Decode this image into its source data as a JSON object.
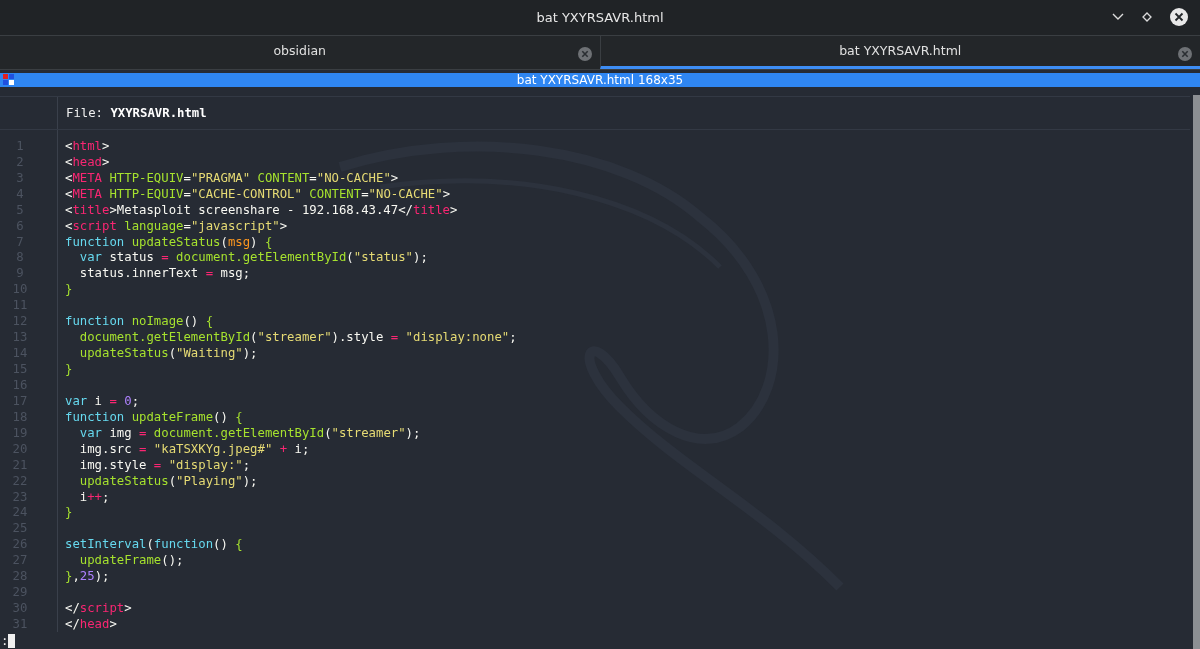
{
  "window": {
    "title": "bat YXYRSAVR.html"
  },
  "tabs": [
    {
      "label": "obsidian",
      "selected": false
    },
    {
      "label": "bat YXYRSAVR.html",
      "selected": true
    }
  ],
  "terminal": {
    "title": "bat YXYRSAVR.html 168x35",
    "file_label": "File:",
    "file_name": "YXYRSAVR.html",
    "lines": [
      {
        "number": "1",
        "tokens": [
          {
            "kind": "plain",
            "text": "<"
          },
          {
            "kind": "tag",
            "text": "html"
          },
          {
            "kind": "plain",
            "text": ">"
          }
        ]
      },
      {
        "number": "2",
        "tokens": [
          {
            "kind": "plain",
            "text": "<"
          },
          {
            "kind": "tag",
            "text": "head"
          },
          {
            "kind": "plain",
            "text": ">"
          }
        ]
      },
      {
        "number": "3",
        "tokens": [
          {
            "kind": "plain",
            "text": "<"
          },
          {
            "kind": "tag",
            "text": "META"
          },
          {
            "kind": "attr",
            "text": " HTTP-EQUIV"
          },
          {
            "kind": "plain",
            "text": "="
          },
          {
            "kind": "str",
            "text": "\"PRAGMA\""
          },
          {
            "kind": "attr",
            "text": " CONTENT"
          },
          {
            "kind": "plain",
            "text": "="
          },
          {
            "kind": "str",
            "text": "\"NO-CACHE\""
          },
          {
            "kind": "plain",
            "text": ">"
          }
        ]
      },
      {
        "number": "4",
        "tokens": [
          {
            "kind": "plain",
            "text": "<"
          },
          {
            "kind": "tag",
            "text": "META"
          },
          {
            "kind": "attr",
            "text": " HTTP-EQUIV"
          },
          {
            "kind": "plain",
            "text": "="
          },
          {
            "kind": "str",
            "text": "\"CACHE-CONTROL\""
          },
          {
            "kind": "attr",
            "text": " CONTENT"
          },
          {
            "kind": "plain",
            "text": "="
          },
          {
            "kind": "str",
            "text": "\"NO-CACHE\""
          },
          {
            "kind": "plain",
            "text": ">"
          }
        ]
      },
      {
        "number": "5",
        "tokens": [
          {
            "kind": "plain",
            "text": "<"
          },
          {
            "kind": "tag",
            "text": "title"
          },
          {
            "kind": "plain",
            "text": ">Metasploit screenshare - 192.168.43.47</"
          },
          {
            "kind": "tag",
            "text": "title"
          },
          {
            "kind": "plain",
            "text": ">"
          }
        ]
      },
      {
        "number": "6",
        "tokens": [
          {
            "kind": "plain",
            "text": "<"
          },
          {
            "kind": "tag",
            "text": "script"
          },
          {
            "kind": "attr",
            "text": " language"
          },
          {
            "kind": "plain",
            "text": "="
          },
          {
            "kind": "str",
            "text": "\"javascript\""
          },
          {
            "kind": "plain",
            "text": ">"
          }
        ]
      },
      {
        "number": "7",
        "tokens": [
          {
            "kind": "kw",
            "text": "function"
          },
          {
            "kind": "fn",
            "text": " updateStatus"
          },
          {
            "kind": "plain",
            "text": "("
          },
          {
            "kind": "param",
            "text": "msg"
          },
          {
            "kind": "plain",
            "text": ")"
          },
          {
            "kind": "fn",
            "text": " {"
          }
        ]
      },
      {
        "number": "8",
        "tokens": [
          {
            "kind": "kw",
            "text": "  var"
          },
          {
            "kind": "plain",
            "text": " status "
          },
          {
            "kind": "op",
            "text": "="
          },
          {
            "kind": "fn",
            "text": " document.getElementById"
          },
          {
            "kind": "plain",
            "text": "("
          },
          {
            "kind": "str",
            "text": "\"status\""
          },
          {
            "kind": "plain",
            "text": ");"
          }
        ]
      },
      {
        "number": "9",
        "tokens": [
          {
            "kind": "plain",
            "text": "  status.innerText "
          },
          {
            "kind": "op",
            "text": "="
          },
          {
            "kind": "plain",
            "text": " msg;"
          }
        ]
      },
      {
        "number": "10",
        "tokens": [
          {
            "kind": "fn",
            "text": "}"
          }
        ]
      },
      {
        "number": "11"
      },
      {
        "number": "12",
        "tokens": [
          {
            "kind": "kw",
            "text": "function"
          },
          {
            "kind": "fn",
            "text": " noImage"
          },
          {
            "kind": "plain",
            "text": "()"
          },
          {
            "kind": "fn",
            "text": " {"
          }
        ]
      },
      {
        "number": "13",
        "tokens": [
          {
            "kind": "fn",
            "text": "  document.getElementById"
          },
          {
            "kind": "plain",
            "text": "("
          },
          {
            "kind": "str",
            "text": "\"streamer\""
          },
          {
            "kind": "plain",
            "text": ").style "
          },
          {
            "kind": "op",
            "text": "="
          },
          {
            "kind": "str",
            "text": " \"display:none\""
          },
          {
            "kind": "plain",
            "text": ";"
          }
        ]
      },
      {
        "number": "14",
        "tokens": [
          {
            "kind": "fn",
            "text": "  updateStatus"
          },
          {
            "kind": "plain",
            "text": "("
          },
          {
            "kind": "str",
            "text": "\"Waiting\""
          },
          {
            "kind": "plain",
            "text": ");"
          }
        ]
      },
      {
        "number": "15",
        "tokens": [
          {
            "kind": "fn",
            "text": "}"
          }
        ]
      },
      {
        "number": "16"
      },
      {
        "number": "17",
        "tokens": [
          {
            "kind": "kw",
            "text": "var"
          },
          {
            "kind": "plain",
            "text": " i "
          },
          {
            "kind": "op",
            "text": "="
          },
          {
            "kind": "num",
            "text": " 0"
          },
          {
            "kind": "plain",
            "text": ";"
          }
        ]
      },
      {
        "number": "18",
        "tokens": [
          {
            "kind": "kw",
            "text": "function"
          },
          {
            "kind": "fn",
            "text": " updateFrame"
          },
          {
            "kind": "plain",
            "text": "()"
          },
          {
            "kind": "fn",
            "text": " {"
          }
        ]
      },
      {
        "number": "19",
        "tokens": [
          {
            "kind": "kw",
            "text": "  var"
          },
          {
            "kind": "plain",
            "text": " img "
          },
          {
            "kind": "op",
            "text": "="
          },
          {
            "kind": "fn",
            "text": " document.getElementById"
          },
          {
            "kind": "plain",
            "text": "("
          },
          {
            "kind": "str",
            "text": "\"streamer\""
          },
          {
            "kind": "plain",
            "text": ");"
          }
        ]
      },
      {
        "number": "20",
        "tokens": [
          {
            "kind": "plain",
            "text": "  img.src "
          },
          {
            "kind": "op",
            "text": "="
          },
          {
            "kind": "str",
            "text": " \"kaTSXKYg.jpeg#\""
          },
          {
            "kind": "op",
            "text": " +"
          },
          {
            "kind": "plain",
            "text": " i;"
          }
        ]
      },
      {
        "number": "21",
        "tokens": [
          {
            "kind": "plain",
            "text": "  img.style "
          },
          {
            "kind": "op",
            "text": "="
          },
          {
            "kind": "str",
            "text": " \"display:\""
          },
          {
            "kind": "plain",
            "text": ";"
          }
        ]
      },
      {
        "number": "22",
        "tokens": [
          {
            "kind": "fn",
            "text": "  updateStatus"
          },
          {
            "kind": "plain",
            "text": "("
          },
          {
            "kind": "str",
            "text": "\"Playing\""
          },
          {
            "kind": "plain",
            "text": ");"
          }
        ]
      },
      {
        "number": "23",
        "tokens": [
          {
            "kind": "plain",
            "text": "  i"
          },
          {
            "kind": "op",
            "text": "++"
          },
          {
            "kind": "plain",
            "text": ";"
          }
        ]
      },
      {
        "number": "24",
        "tokens": [
          {
            "kind": "fn",
            "text": "}"
          }
        ]
      },
      {
        "number": "25"
      },
      {
        "number": "26",
        "tokens": [
          {
            "kind": "kw",
            "text": "setInterval"
          },
          {
            "kind": "plain",
            "text": "("
          },
          {
            "kind": "kw",
            "text": "function"
          },
          {
            "kind": "plain",
            "text": "()"
          },
          {
            "kind": "fn",
            "text": " {"
          }
        ]
      },
      {
        "number": "27",
        "tokens": [
          {
            "kind": "fn",
            "text": "  updateFrame"
          },
          {
            "kind": "plain",
            "text": "();"
          }
        ]
      },
      {
        "number": "28",
        "tokens": [
          {
            "kind": "fn",
            "text": "}"
          },
          {
            "kind": "plain",
            "text": ","
          },
          {
            "kind": "num",
            "text": "25"
          },
          {
            "kind": "plain",
            "text": ");"
          }
        ]
      },
      {
        "number": "29"
      },
      {
        "number": "30",
        "tokens": [
          {
            "kind": "plain",
            "text": "</"
          },
          {
            "kind": "tag",
            "text": "script"
          },
          {
            "kind": "plain",
            "text": ">"
          }
        ]
      },
      {
        "number": "31",
        "tokens": [
          {
            "kind": "plain",
            "text": "</"
          },
          {
            "kind": "tag",
            "text": "head"
          },
          {
            "kind": "plain",
            "text": ">"
          }
        ]
      }
    ],
    "prompt": ":"
  }
}
